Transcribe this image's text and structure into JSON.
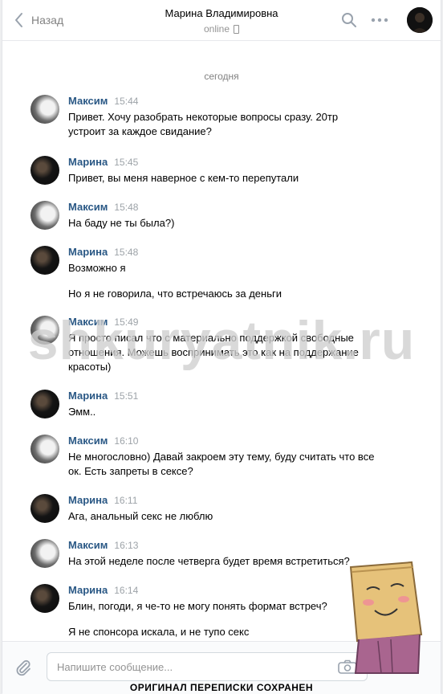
{
  "header": {
    "back_label": "Назад",
    "title": "Марина Владимировна",
    "status": "online"
  },
  "date_separator": "сегодня",
  "messages": [
    {
      "author": "Максим",
      "time": "15:44",
      "paragraphs": [
        "Привет. Хочу разобрать некоторые вопросы сразу. 20тр устроит за каждое свидание?"
      ]
    },
    {
      "author": "Марина",
      "time": "15:45",
      "paragraphs": [
        "Привет, вы меня наверное с кем-то перепутали"
      ]
    },
    {
      "author": "Максим",
      "time": "15:48",
      "paragraphs": [
        "На баду не ты была?)"
      ]
    },
    {
      "author": "Марина",
      "time": "15:48",
      "paragraphs": [
        "Возможно я",
        "Но я не говорила, что встречаюсь за деньги"
      ]
    },
    {
      "author": "Максим",
      "time": "15:49",
      "paragraphs": [
        "Я просто писал что с материально поддержкой свободные отношения. Можешь воспринимать это как на поддержание красоты)"
      ]
    },
    {
      "author": "Марина",
      "time": "15:51",
      "paragraphs": [
        "Эмм.."
      ]
    },
    {
      "author": "Максим",
      "time": "16:10",
      "paragraphs": [
        "Не многословно) Давай закроем эту тему, буду считать что все ок. Есть запреты в сексе?"
      ]
    },
    {
      "author": "Марина",
      "time": "16:11",
      "paragraphs": [
        "Ага, анальный секс не люблю"
      ]
    },
    {
      "author": "Максим",
      "time": "16:13",
      "paragraphs": [
        "На этой неделе после четверга будет время встретиться?"
      ]
    },
    {
      "author": "Марина",
      "time": "16:14",
      "paragraphs": [
        "Блин, погоди, я че-то не могу понять формат встреч?",
        "Я не спонсора искала, и не тупо секс"
      ]
    }
  ],
  "watermark": "shkuryatnik.ru",
  "composer": {
    "placeholder": "Напишите сообщение..."
  },
  "footer_note": "ОРИГИНАЛ ПЕРЕПИСКИ СОХРАНЕН",
  "colors": {
    "author": "#2a5885",
    "time": "#9da3a8",
    "background": "#edeef0",
    "panel": "#ffffff"
  },
  "icons": [
    "chevron-left-icon",
    "search-icon",
    "more-icon",
    "phone-icon",
    "paperclip-icon",
    "camera-icon"
  ]
}
